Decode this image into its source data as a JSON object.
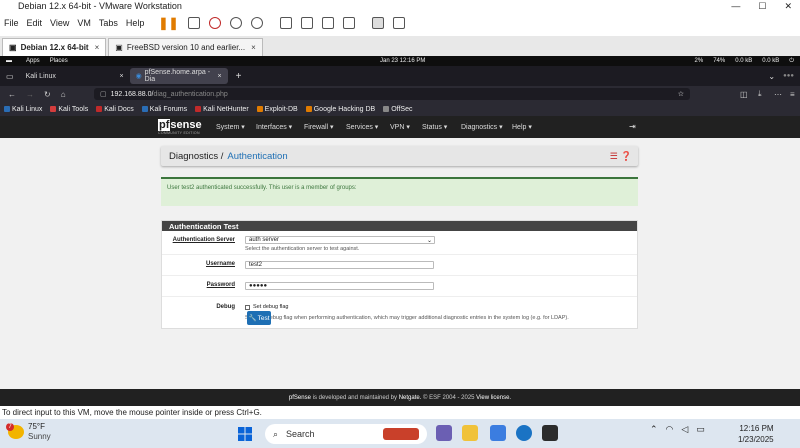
{
  "vm": {
    "title": "Debian 12.x 64-bit - VMware Workstation",
    "menu": [
      "File",
      "Edit",
      "View",
      "VM",
      "Tabs",
      "Help"
    ],
    "tabs": [
      {
        "label": "Debian 12.x 64-bit",
        "close": "×"
      },
      {
        "label": "FreeBSD version 10 and earlier...",
        "close": "×"
      }
    ],
    "status": "To direct input to this VM, move the mouse pointer inside or press Ctrl+G."
  },
  "gnome": {
    "apps": "Apps",
    "places": "Places",
    "clock": "Jan 23  12:16 PM",
    "status": [
      "2%",
      "74%",
      "0.0 kB",
      "0.0 kB"
    ]
  },
  "firefox": {
    "tabs": [
      {
        "label": "Kali Linux",
        "close": "×"
      },
      {
        "label": "pfSense.home.arpa - Dia",
        "close": "×"
      }
    ],
    "new_tab": "+",
    "url_host": "192.168.88.0/",
    "url_path": "diag_authentication.php",
    "bookmarks": [
      {
        "label": "Kali Linux",
        "color": "#2a6db5"
      },
      {
        "label": "Kali Tools",
        "color": "#d43d3d"
      },
      {
        "label": "Kali Docs",
        "color": "#c02a2a"
      },
      {
        "label": "Kali Forums",
        "color": "#2a6db5"
      },
      {
        "label": "Kali NetHunter",
        "color": "#c02a2a"
      },
      {
        "label": "Exploit-DB",
        "color": "#e07b00"
      },
      {
        "label": "Google Hacking DB",
        "color": "#e07b00"
      },
      {
        "label": "OffSec",
        "color": "#888888"
      }
    ]
  },
  "pfsense": {
    "logo_a": "pf",
    "logo_b": "sense",
    "logo_sub": "COMMUNITY EDITION",
    "nav": [
      "System ▾",
      "Interfaces ▾",
      "Firewall ▾",
      "Services ▾",
      "VPN ▾",
      "Status ▾",
      "Diagnostics ▾",
      "Help ▾"
    ],
    "breadcrumb_1": "Diagnostics /",
    "breadcrumb_2": "Authentication",
    "alert": "User test2 authenticated successfully. This user is a member of groups:",
    "panel_title": "Authentication Test",
    "server_label": "Authentication Server",
    "server_value": "auth server",
    "server_help": "Select the authentication server to test against.",
    "username_label": "Username",
    "username_value": "test2",
    "password_label": "Password",
    "password_value": "●●●●●",
    "debug_label": "Debug",
    "debug_check": "Set debug flag",
    "debug_help": "Sets the debug flag when performing authentication, which may trigger additional diagnostic entries in the system log (e.g. for LDAP).",
    "test_button": "Test",
    "footer_a": "pfSense",
    "footer_b": "is developed and maintained by",
    "footer_c": "Netgate.",
    "footer_d": "© ESF 2004 - 2025",
    "footer_e": "View license."
  },
  "taskbar": {
    "temp": "75°F",
    "weather": "Sunny",
    "badge": "7",
    "search": "Search",
    "time": "12:16 PM",
    "date": "1/23/2025"
  }
}
